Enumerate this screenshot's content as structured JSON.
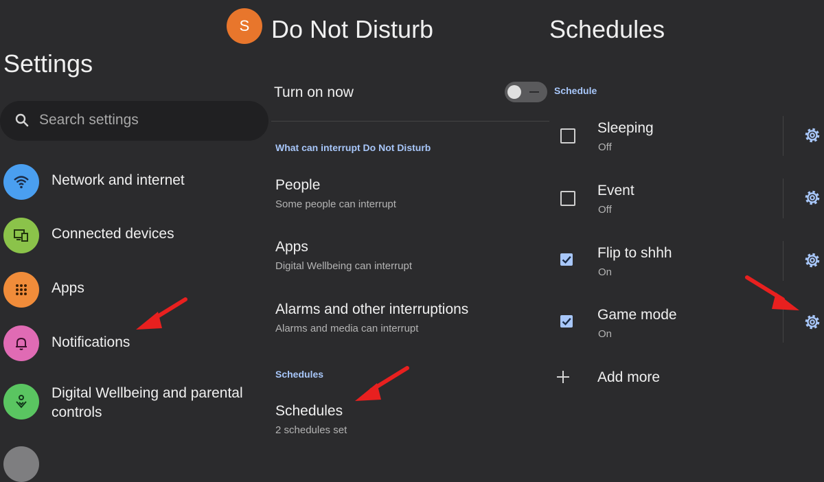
{
  "settings": {
    "title": "Settings",
    "search_placeholder": "Search settings",
    "items": [
      {
        "label": "Network and internet",
        "icon": "wifi-icon",
        "color": "#4a9ff0"
      },
      {
        "label": "Connected devices",
        "icon": "devices-icon",
        "color": "#8bc34a"
      },
      {
        "label": "Apps",
        "icon": "apps-grid-icon",
        "color": "#f08c3a"
      },
      {
        "label": "Notifications",
        "icon": "bell-icon",
        "color": "#e06bb4"
      },
      {
        "label": "Digital Wellbeing and parental controls",
        "icon": "wellbeing-icon",
        "color": "#5ac561"
      }
    ]
  },
  "dnd": {
    "avatar_letter": "S",
    "avatar_color": "#e8762c",
    "title": "Do Not Disturb",
    "turn_on_label": "Turn on now",
    "toggle_state": "off",
    "interrupt_header": "What can interrupt Do Not Disturb",
    "rows": [
      {
        "title": "People",
        "subtitle": "Some people can interrupt"
      },
      {
        "title": "Apps",
        "subtitle": "Digital Wellbeing can interrupt"
      },
      {
        "title": "Alarms and other interruptions",
        "subtitle": "Alarms and media can interrupt"
      }
    ],
    "schedules_header": "Schedules",
    "schedules_row": {
      "title": "Schedules",
      "subtitle": "2 schedules set"
    }
  },
  "schedules": {
    "title": "Schedules",
    "section_header": "Schedule",
    "items": [
      {
        "name": "Sleeping",
        "status": "Off",
        "checked": false
      },
      {
        "name": "Event",
        "status": "Off",
        "checked": false
      },
      {
        "name": "Flip to shhh",
        "status": "On",
        "checked": true
      },
      {
        "name": "Game mode",
        "status": "On",
        "checked": true
      }
    ],
    "add_more_label": "Add more"
  },
  "colors": {
    "accent": "#a8c7fa",
    "annotation_arrow": "#e8201f",
    "background": "#2b2b2d"
  }
}
